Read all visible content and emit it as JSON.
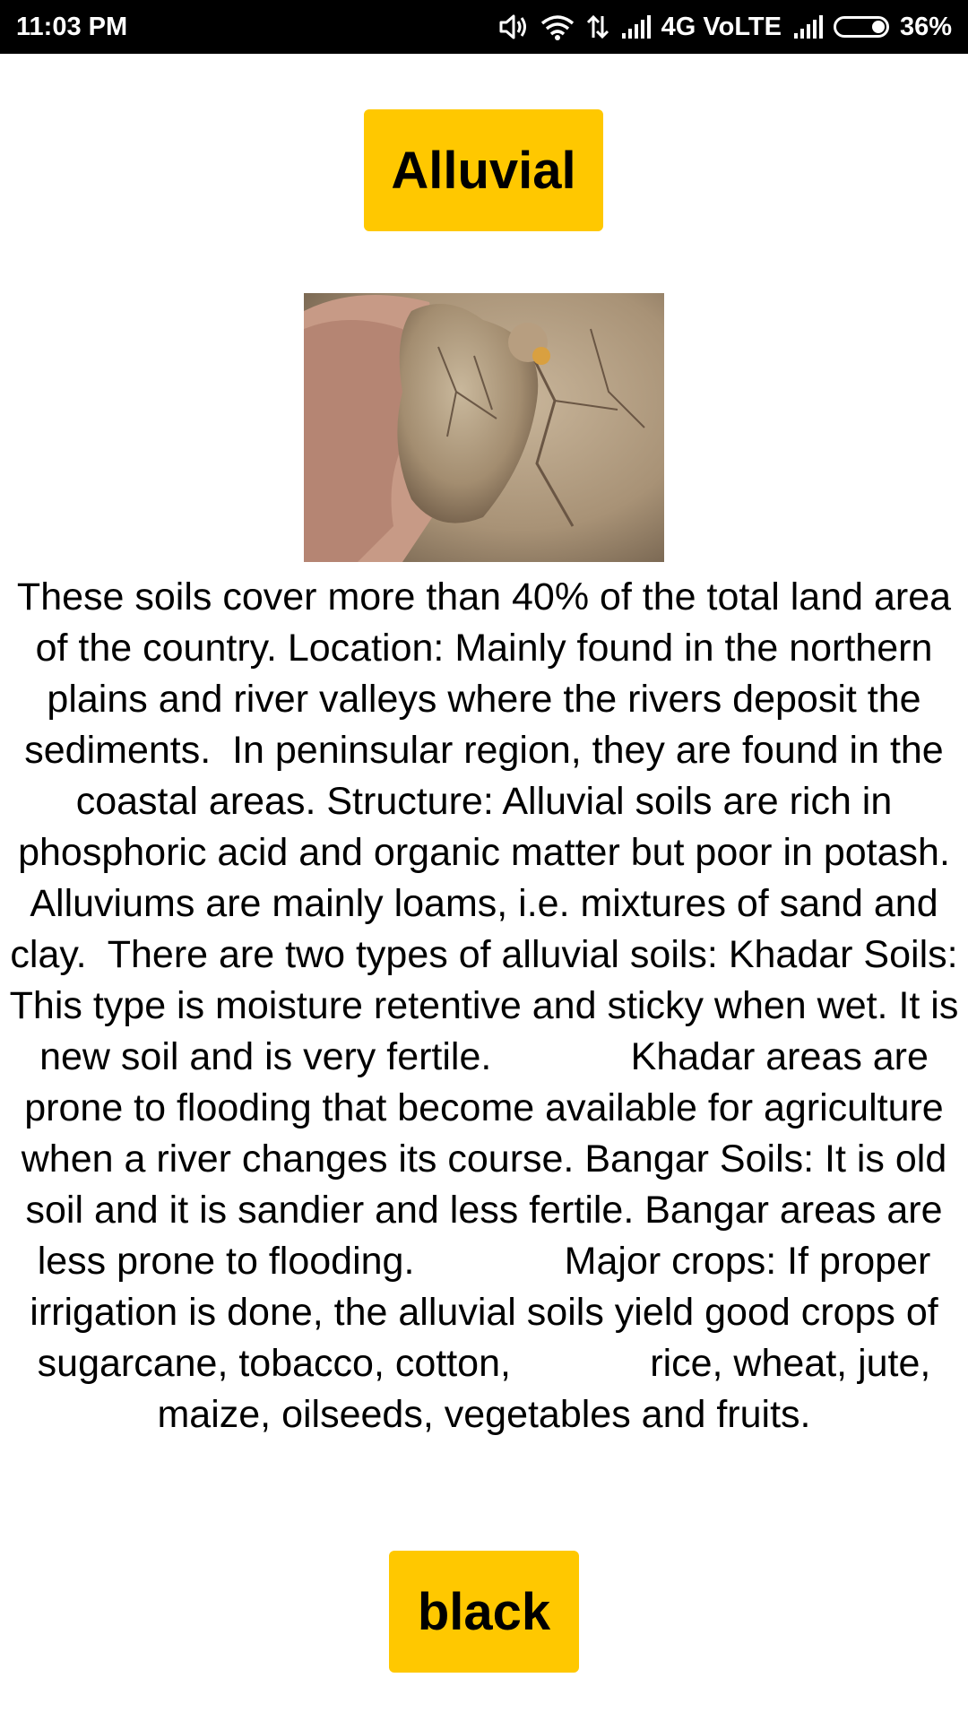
{
  "status_bar": {
    "time": "11:03 PM",
    "network": "4G VoLTE",
    "battery": "36%",
    "icons": [
      "volume-icon",
      "wifi-icon",
      "data-transfer-icon",
      "signal-icon",
      "signal-icon",
      "battery-icon"
    ]
  },
  "title_button": {
    "label": "Alluvial"
  },
  "image": {
    "description": "soil-photo",
    "icon": "soil-photo"
  },
  "content": {
    "text": "These soils cover more than 40% of the total land area of the country. Location: Mainly found in the northern plains and river valleys where the rivers deposit the sediments.  In peninsular region, they are found in the coastal areas. Structure: Alluvial soils are rich in phosphoric acid and organic matter but poor in potash. Alluviums are mainly loams, i.e. mixtures of sand and clay.  There are two types of alluvial soils: Khadar Soils: This type is moisture retentive and sticky when wet. It is new soil and is very fertile.             Khadar areas are prone to flooding that become available for agriculture when a river changes its course. Bangar Soils: It is old soil and it is sandier and less fertile. Bangar areas are less prone to flooding.              Major crops: If proper irrigation is done, the alluvial soils yield good crops of sugarcane, tobacco, cotton,             rice, wheat, jute, maize, oilseeds, vegetables and fruits."
  },
  "bottom_button": {
    "label": "black"
  },
  "colors": {
    "button": "#ffc800",
    "status_bar": "#000000",
    "background": "#ffffff"
  }
}
